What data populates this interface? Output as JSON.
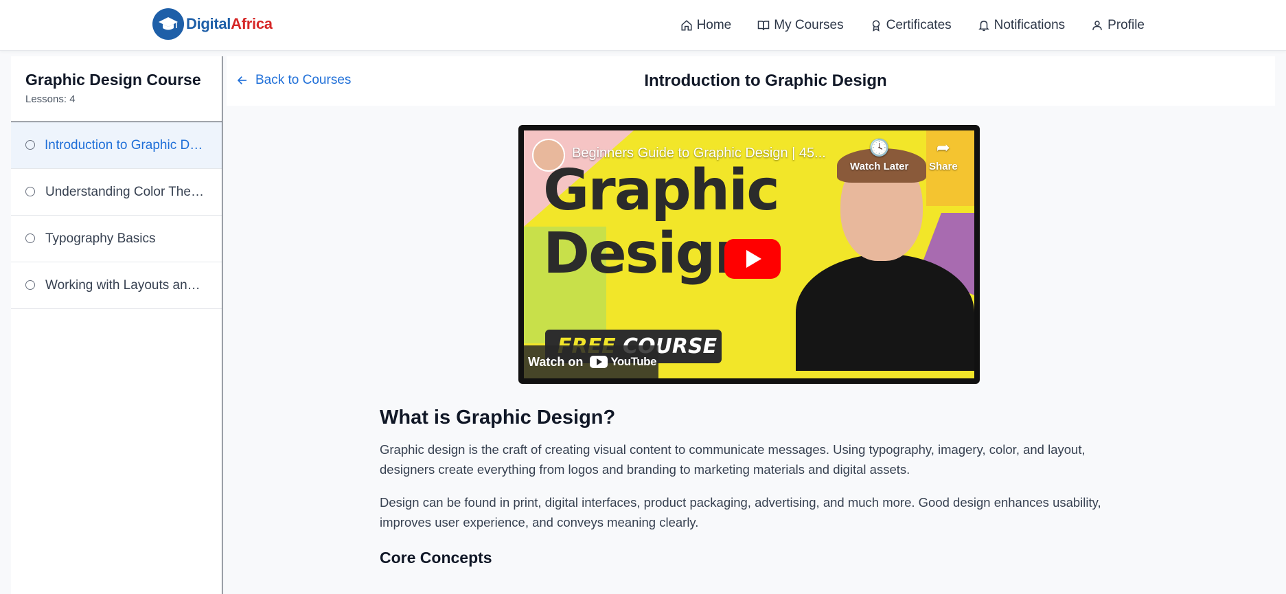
{
  "brand": {
    "name_part1": "Digital",
    "name_part2": "Africa"
  },
  "nav": {
    "items": [
      {
        "label": "Home",
        "icon": "home-icon"
      },
      {
        "label": "My Courses",
        "icon": "book-icon"
      },
      {
        "label": "Certificates",
        "icon": "award-icon"
      },
      {
        "label": "Notifications",
        "icon": "bell-icon"
      },
      {
        "label": "Profile",
        "icon": "user-icon"
      }
    ]
  },
  "sidebar": {
    "course_title": "Graphic Design Course",
    "lessons_count": "Lessons: 4",
    "lessons": [
      {
        "label": "Introduction to Graphic Design"
      },
      {
        "label": "Understanding Color Theory"
      },
      {
        "label": "Typography Basics"
      },
      {
        "label": "Working with Layouts and Grids"
      }
    ]
  },
  "header": {
    "back_label": "Back to Courses",
    "lesson_title": "Introduction to Graphic Design"
  },
  "video": {
    "title": "Beginners Guide to Graphic Design | 45...",
    "watch_later": "Watch Later",
    "share": "Share",
    "thumbnail_line1": "Graphic",
    "thumbnail_line2": "Design",
    "badge_free": "FREE",
    "badge_course": " COURSE",
    "watch_on": "Watch on",
    "youtube": "YouTube",
    "colors": {
      "play_button": "#ff0000",
      "background": "#f2e629"
    }
  },
  "content": {
    "heading": "What is Graphic Design?",
    "paragraph1": "Graphic design is the craft of creating visual content to communicate messages. Using typography, imagery, color, and layout, designers create everything from logos and branding to marketing materials and digital assets.",
    "paragraph2": "Design can be found in print, digital interfaces, product packaging, advertising, and much more. Good design enhances usability, improves user experience, and conveys meaning clearly.",
    "subheading": "Core Concepts"
  },
  "colors": {
    "accent": "#1f6fd8",
    "brand_blue": "#1e5fa8",
    "brand_red": "#d62828"
  }
}
